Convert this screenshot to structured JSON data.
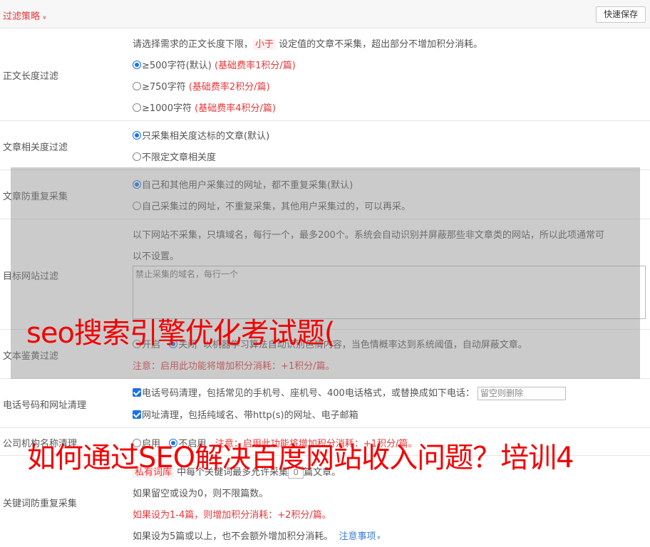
{
  "header": {
    "title": "过滤策略",
    "chevron": "»",
    "save_label": "快速保存"
  },
  "length_filter": {
    "label": "正文长度过滤",
    "desc_pre": "请选择需求的正文长度下限，",
    "desc_tag": "小于",
    "desc_post": "设定值的文章不采集，超出部分不增加积分消耗。",
    "options": [
      {
        "text": "≥500字符(默认)",
        "rate": "(基础费率1积分/篇)",
        "checked": true
      },
      {
        "text": "≥750字符",
        "rate": "(基础费率2积分/篇)",
        "checked": false
      },
      {
        "text": "≥1000字符",
        "rate": "(基础费率4积分/篇)",
        "checked": false
      }
    ]
  },
  "relevance_filter": {
    "label": "文章相关度过滤",
    "options": [
      {
        "text": "只采集相关度达标的文章(默认)"
      },
      {
        "text": "不限定文章相关度"
      }
    ]
  },
  "dup_filter": {
    "label": "文章防重复采集",
    "options": [
      {
        "text": "自己和其他用户采集过的网址，都不重复采集(默认)"
      },
      {
        "text": "自己采集过的网址，不重复采集，其他用户采集过的，可以再采。"
      }
    ]
  },
  "site_filter": {
    "label": "目标网站过滤",
    "desc1": "以下网站不采集，只填域名，每行一个，最多200个。系统会自动识别并屏蔽那些非文章类的网站，所以此项通常可",
    "desc2": "以不设置。",
    "placeholder": "禁止采集的域名，每行一个"
  },
  "porn_filter": {
    "label": "文本鉴黄过滤",
    "on": "开启",
    "off": "关闭",
    "desc": "以机器学习算法自动识别色情内容，当色情概率达到系统阈值，自动屏蔽文章。",
    "note": "注意：启用此功能将增加积分消耗：+1积分/篇。"
  },
  "contact_filter": {
    "label": "电话号码和网址清理",
    "phone": "电话号码清理，包括常见的手机号、座机号、400电话格式，或替换成如下电话：",
    "phone_placeholder": "留空则删除",
    "url": "网址清理，包括纯域名、带http(s)的网址、电子邮箱"
  },
  "org_filter": {
    "label": "公司机构名称清理",
    "on": "启用",
    "off": "不启用",
    "note": "注意：启用此功能将增加积分消耗：+1积分/篇。"
  },
  "keyword_filter": {
    "label": "关键词防重复采集",
    "tag": "私有词库",
    "line1_pre": "中每个关键词最多允许采集",
    "count": "0",
    "line1_post": "篇文章。",
    "line2": "如果留空或设为0，则不限篇数。",
    "line3": "如果设为1-4篇，则增加积分消耗：+2积分/篇。",
    "line4": "如果设为5篇或以上，也不会额外增加积分消耗。",
    "link": "注意事项",
    "link_chevron": "»"
  },
  "watermark": {
    "line1": "seo搜索引擎优化考试题(",
    "line2": "如何通过SEO解决百度网站收入问题？培训4"
  }
}
